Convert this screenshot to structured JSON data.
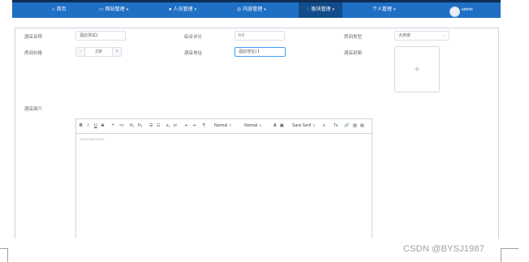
{
  "nav": {
    "items": [
      {
        "icon": "home-icon",
        "glyph": "⌂",
        "label": "首页"
      },
      {
        "icon": "monitor-icon",
        "glyph": "▭",
        "label": "网站管理"
      },
      {
        "icon": "user-icon",
        "glyph": "●",
        "label": "人员管理"
      },
      {
        "icon": "compass-icon",
        "glyph": "◎",
        "label": "内容管理"
      },
      {
        "icon": "chat-icon",
        "glyph": "◌",
        "label": "板块管理"
      },
      {
        "icon": "",
        "glyph": "",
        "label": "个人管理"
      }
    ],
    "active_index": 4,
    "user_name": "admin"
  },
  "form": {
    "hotel_name": {
      "label": "酒店名称",
      "value": "酒店测试1"
    },
    "rating": {
      "label": "综合评分",
      "value": "0.0"
    },
    "room_type": {
      "label": "房间类型",
      "value": "大床房"
    },
    "room_price": {
      "label": "房间价格",
      "value": "238",
      "minus": "−",
      "plus": "+"
    },
    "address": {
      "label": "酒店地址",
      "value": "酒店地址1"
    },
    "cover": {
      "label": "酒店封面",
      "upload_glyph": "+"
    },
    "intro": {
      "label": "酒店简介"
    }
  },
  "editor": {
    "toolbar": {
      "bold": "B",
      "italic": "I",
      "underline": "U",
      "strike": "S",
      "quote": "❝",
      "code": "<>",
      "h1": "H₁",
      "h2": "H₂",
      "ordered_list": "☰",
      "bullet_list": "☷",
      "subscript": "x₂",
      "superscript": "x²",
      "outdent": "⇤",
      "indent": "⇥",
      "direction": "¶",
      "size": "Normal",
      "header": "Normal",
      "color": "A",
      "background": "▣",
      "font": "Sans Serif",
      "align": "≡",
      "clean": "Tx",
      "link": "🔗",
      "image": "▨",
      "video": "▤"
    },
    "placeholder": "Insert text here ..."
  },
  "watermark": "CSDN @BYSJ1987"
}
